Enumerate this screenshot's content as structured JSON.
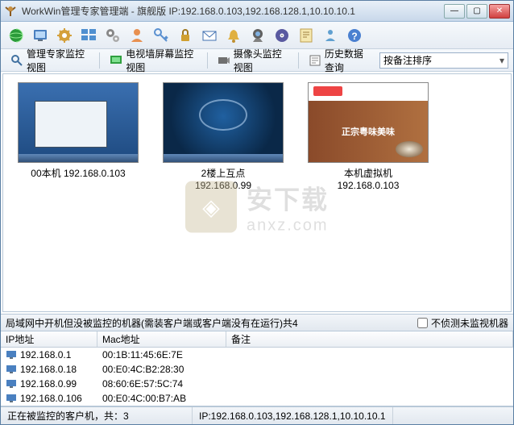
{
  "window": {
    "title": "WorkWin管理专家管理端 - 旗舰版 IP:192.168.0.103,192.168.128.1,10.10.10.1"
  },
  "viewtabs": {
    "t1": "管理专家监控视图",
    "t2": "电视墙屏幕监控视图",
    "t3": "摄像头监控视图",
    "t4": "历史数据查询"
  },
  "sort": {
    "selected": "按备注排序"
  },
  "thumbs": [
    {
      "line1": "00本机 192.168.0.103",
      "line2": ""
    },
    {
      "line1": "2楼上互点",
      "line2": "192.168.0.99"
    },
    {
      "line1": "本机虚拟机",
      "line2": "192.168.0.103"
    }
  ],
  "watermark": {
    "line1": "安下载",
    "line2": "anxz.com"
  },
  "panel": {
    "heading": "局域网中开机但没被监控的机器(需装客户端或客户端没有在运行)共4",
    "checkbox_label": "不侦测未监视机器"
  },
  "columns": {
    "c1": "IP地址",
    "c2": "Mac地址",
    "c3": "备注"
  },
  "rows": [
    {
      "ip": "192.168.0.1",
      "mac": "00:1B:11:45:6E:7E",
      "note": ""
    },
    {
      "ip": "192.168.0.18",
      "mac": "00:E0:4C:B2:28:30",
      "note": ""
    },
    {
      "ip": "192.168.0.99",
      "mac": "08:60:6E:57:5C:74",
      "note": ""
    },
    {
      "ip": "192.168.0.106",
      "mac": "00:E0:4C:00:B7:AB",
      "note": ""
    }
  ],
  "status": {
    "left": "正在被监控的客户机，共：3",
    "right": "IP:192.168.0.103,192.168.128.1,10.10.10.1"
  },
  "hero_text": "正宗粤味美味"
}
